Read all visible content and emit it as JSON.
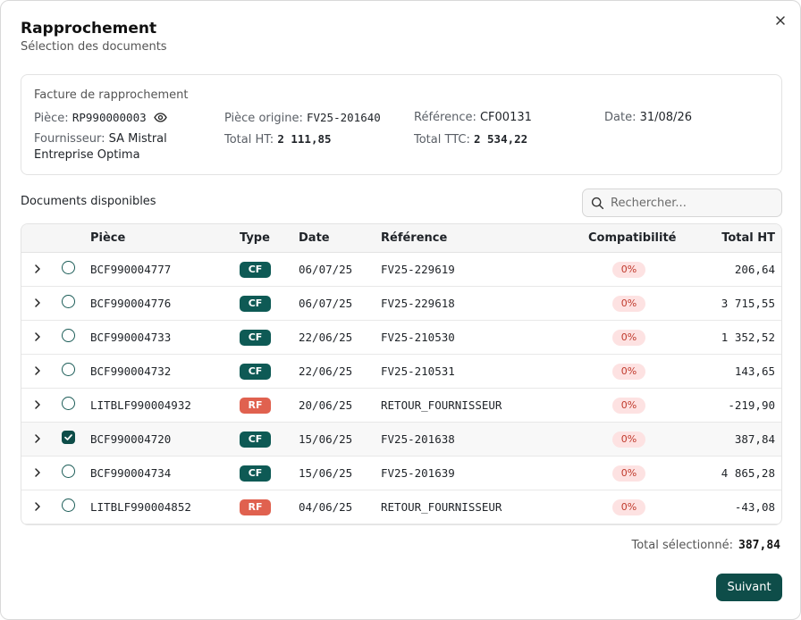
{
  "dialog": {
    "title": "Rapprochement",
    "subtitle": "Sélection des documents"
  },
  "invoice": {
    "card_title": "Facture de rapprochement",
    "piece_label": "Pièce:",
    "piece_value": "RP990000003",
    "origin_label": "Pièce origine:",
    "origin_value": "FV25-201640",
    "reference_label": "Référence:",
    "reference_value": "CF00131",
    "date_label": "Date:",
    "date_value": "31/08/26",
    "supplier_label": "Fournisseur:",
    "supplier_value_line1": "SA Mistral",
    "supplier_value_line2": "Entreprise Optima",
    "total_ht_label": "Total HT:",
    "total_ht_value": "2 111,85",
    "total_ttc_label": "Total TTC:",
    "total_ttc_value": "2 534,22"
  },
  "documents": {
    "section_label": "Documents disponibles",
    "search_placeholder": "Rechercher...",
    "columns": {
      "piece": "Pièce",
      "type": "Type",
      "date": "Date",
      "reference": "Référence",
      "compat": "Compatibilité",
      "total_ht": "Total HT"
    },
    "rows": [
      {
        "piece": "BCF990004777",
        "type": "CF",
        "date": "06/07/25",
        "reference": "FV25-229619",
        "compat": "0%",
        "total": "206,64",
        "selected": false
      },
      {
        "piece": "BCF990004776",
        "type": "CF",
        "date": "06/07/25",
        "reference": "FV25-229618",
        "compat": "0%",
        "total": "3 715,55",
        "selected": false
      },
      {
        "piece": "BCF990004733",
        "type": "CF",
        "date": "22/06/25",
        "reference": "FV25-210530",
        "compat": "0%",
        "total": "1 352,52",
        "selected": false
      },
      {
        "piece": "BCF990004732",
        "type": "CF",
        "date": "22/06/25",
        "reference": "FV25-210531",
        "compat": "0%",
        "total": "143,65",
        "selected": false
      },
      {
        "piece": "LITBLF990004932",
        "type": "RF",
        "date": "20/06/25",
        "reference": "RETOUR_FOURNISSEUR",
        "compat": "0%",
        "total": "-219,90",
        "selected": false
      },
      {
        "piece": "BCF990004720",
        "type": "CF",
        "date": "15/06/25",
        "reference": "FV25-201638",
        "compat": "0%",
        "total": "387,84",
        "selected": true
      },
      {
        "piece": "BCF990004734",
        "type": "CF",
        "date": "15/06/25",
        "reference": "FV25-201639",
        "compat": "0%",
        "total": "4 865,28",
        "selected": false
      },
      {
        "piece": "LITBLF990004852",
        "type": "RF",
        "date": "04/06/25",
        "reference": "RETOUR_FOURNISSEUR",
        "compat": "0%",
        "total": "-43,08",
        "selected": false
      }
    ]
  },
  "footer": {
    "total_label": "Total sélectionné:",
    "total_value": "387,84",
    "next_label": "Suivant"
  },
  "colors": {
    "primary": "#0e4d49",
    "badge_cf": "#0e5a55",
    "badge_rf": "#e0614f",
    "compat_bg": "#fde2e2",
    "compat_text": "#c0392b"
  },
  "icons": {
    "close": "close-icon",
    "eye": "eye-icon",
    "search": "search-icon",
    "expand": "chevron-right-icon",
    "check": "check-icon"
  }
}
